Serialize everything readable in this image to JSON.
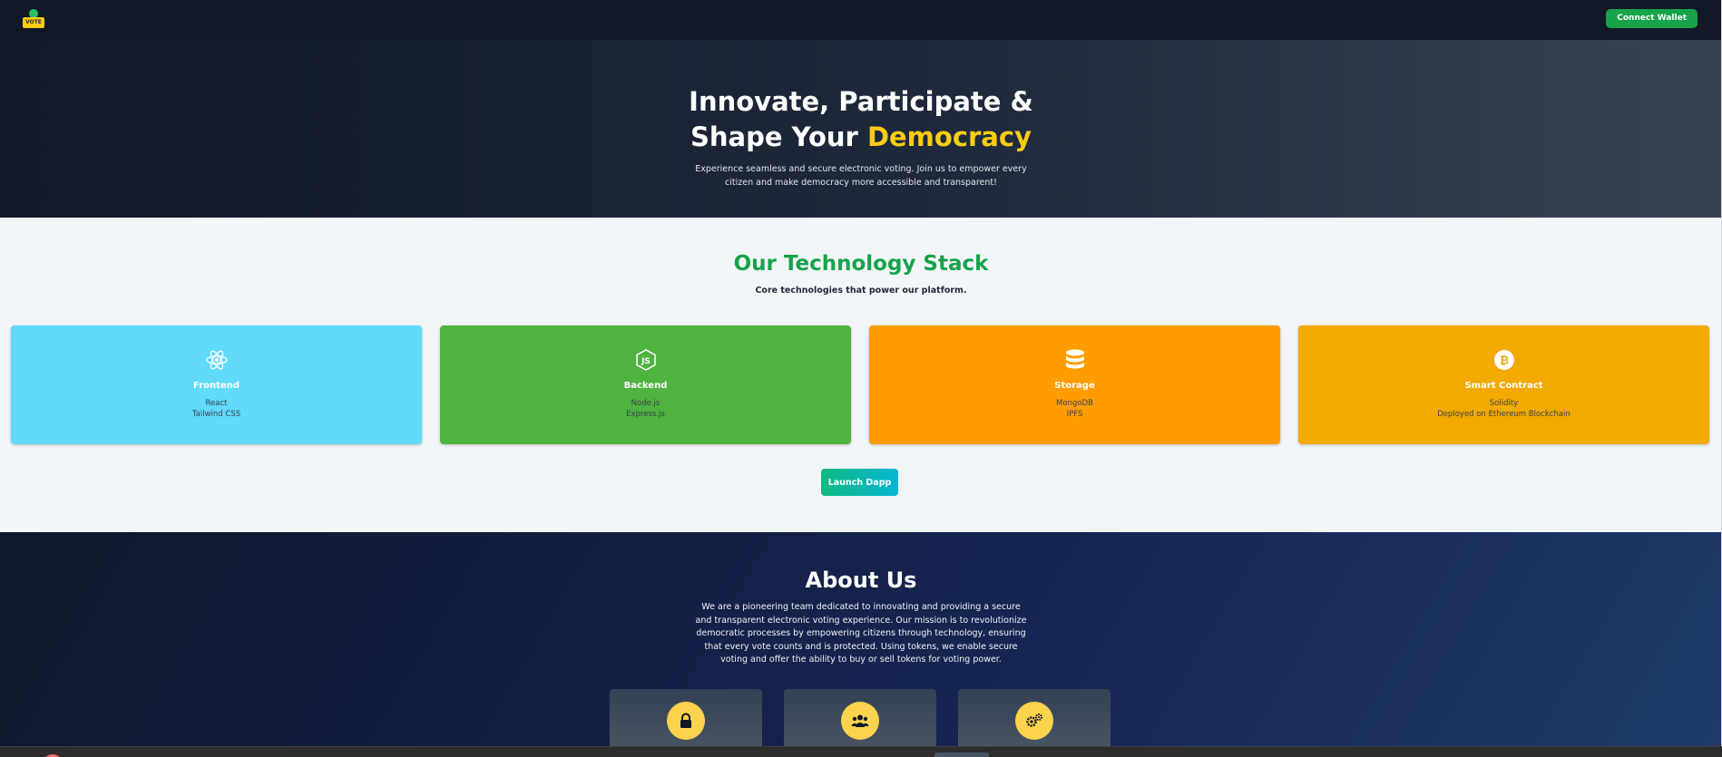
{
  "header": {
    "logo_text": "VOTE",
    "connect_label": "Connect Wallet"
  },
  "hero": {
    "title_line1": "Innovate, Participate &",
    "title_line2_prefix": "Shape Your ",
    "title_line2_accent": "Democracy",
    "subtitle": "Experience seamless and secure electronic voting. Join us to empower every citizen and make democracy more accessible and transparent!"
  },
  "tech": {
    "title": "Our Technology Stack",
    "subtitle": "Core technologies that power our platform.",
    "cards": [
      {
        "name": "Frontend",
        "lines": [
          "React",
          "Tailwind CSS"
        ],
        "color": "#61dafb",
        "icon": "react-icon"
      },
      {
        "name": "Backend",
        "lines": [
          "Node.js",
          "Express.js"
        ],
        "color": "#4fb33f",
        "icon": "nodejs-icon"
      },
      {
        "name": "Storage",
        "lines": [
          "MongoDB",
          "IPFS"
        ],
        "color": "#ff9d00",
        "icon": "database-icon"
      },
      {
        "name": "Smart Contract",
        "lines": [
          "Solidity",
          "Deployed on Ethereum Blockchain"
        ],
        "color": "#f2a900",
        "icon": "bitcoin-icon"
      }
    ],
    "launch_label": "Launch Dapp"
  },
  "about": {
    "title": "About Us",
    "text": "We are a pioneering team dedicated to innovating and providing a secure and transparent electronic voting experience. Our mission is to revolutionize democratic processes by empowering citizens through technology, ensuring that every vote counts and is protected. Using tokens, we enable secure voting and offer the ability to buy or sell tokens for voting power.",
    "features": [
      {
        "icon": "lock-icon"
      },
      {
        "icon": "users-icon"
      },
      {
        "icon": "gears-icon"
      }
    ]
  },
  "colors": {
    "accent_green": "#16a34a",
    "accent_yellow": "#facc15"
  }
}
